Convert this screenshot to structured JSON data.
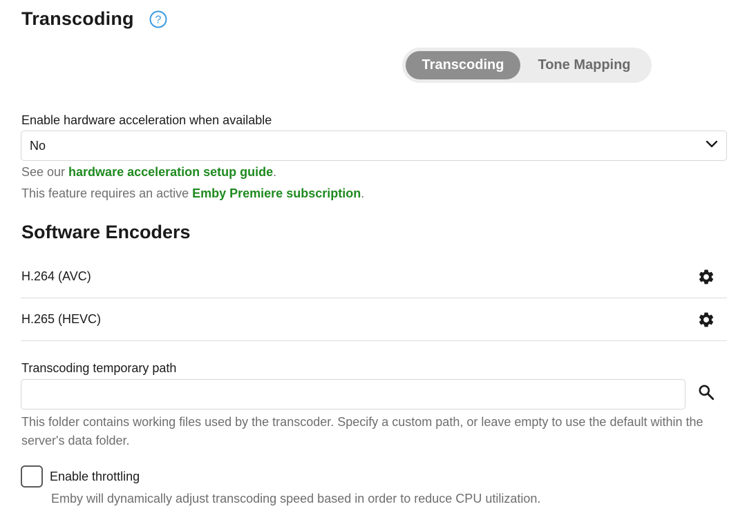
{
  "header": {
    "title": "Transcoding",
    "help_icon": "question-circle-icon"
  },
  "tabs": [
    {
      "label": "Transcoding",
      "active": true
    },
    {
      "label": "Tone Mapping",
      "active": false
    }
  ],
  "hw_accel": {
    "label": "Enable hardware acceleration when available",
    "selected": "No",
    "guide_prefix": "See our ",
    "guide_link": "hardware acceleration setup guide",
    "guide_suffix": ".",
    "premiere_prefix": "This feature requires an active ",
    "premiere_link": "Emby Premiere subscription",
    "premiere_suffix": "."
  },
  "software_encoders": {
    "heading": "Software Encoders",
    "items": [
      {
        "name": "H.264 (AVC)",
        "icon": "gear-icon"
      },
      {
        "name": "H.265 (HEVC)",
        "icon": "gear-icon"
      }
    ]
  },
  "temp_path": {
    "label": "Transcoding temporary path",
    "value": "",
    "search_icon": "search-icon",
    "help": "This folder contains working files used by the transcoder. Specify a custom path, or leave empty to use the default within the server's data folder."
  },
  "throttling": {
    "label": "Enable throttling",
    "checked": false,
    "help": "Emby will dynamically adjust transcoding speed based in order to reduce CPU utilization."
  },
  "colors": {
    "link": "#1f8a1f",
    "help_icon": "#3a9be0",
    "tab_active_bg": "#8e8e8e",
    "tab_track_bg": "#ececec"
  }
}
